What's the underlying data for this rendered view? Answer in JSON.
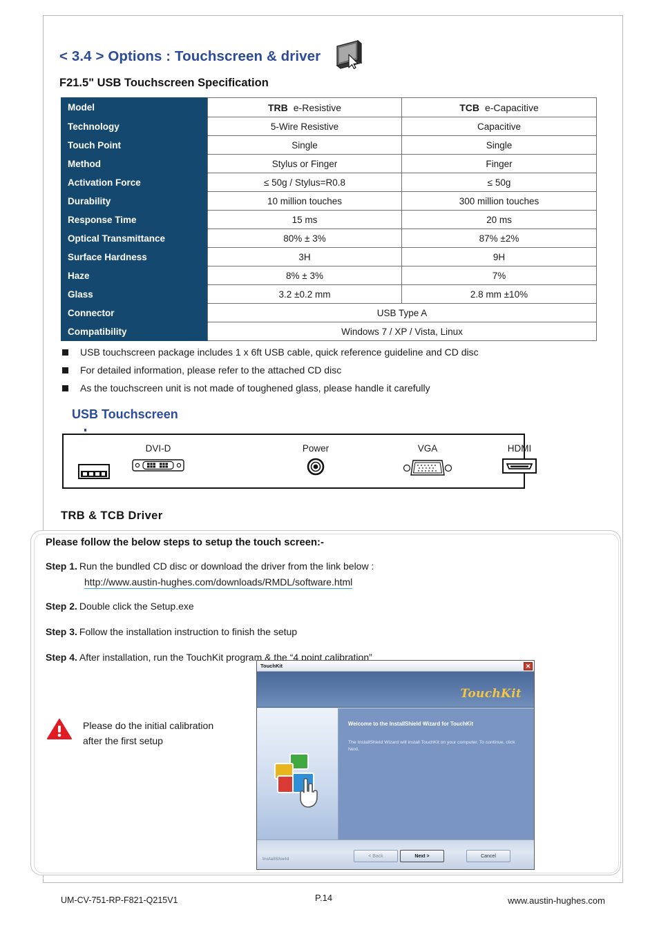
{
  "header": {
    "section_title": "< 3.4 >  Options : Touchscreen & driver",
    "spec_title": "F21.5\" USB Touchscreen Specification",
    "monitor_icon": "touchscreen-monitor-icon"
  },
  "colors": {
    "title_blue": "#2c4a9c",
    "table_head_navy": "#14486e",
    "link_underline": "#3aa8d8",
    "warning_red": "#e01b24"
  },
  "spec_table": {
    "row_header_label": "Model",
    "columns": [
      {
        "code": "TRB",
        "kind": "e-Resistive"
      },
      {
        "code": "TCB",
        "kind": "e-Capacitive"
      }
    ],
    "rows": [
      {
        "label": "Technology",
        "trb": "5-Wire Resistive",
        "tcb": "Capacitive"
      },
      {
        "label": "Touch Point",
        "trb": "Single",
        "tcb": "Single"
      },
      {
        "label": "Method",
        "trb": "Stylus or Finger",
        "tcb": "Finger"
      },
      {
        "label": "Activation Force",
        "trb": "≤ 50g / Stylus=R0.8",
        "tcb": "≤ 50g"
      },
      {
        "label": "Durability",
        "trb": "10 million touches",
        "tcb": "300 million touches"
      },
      {
        "label": "Response Time",
        "trb": "15 ms",
        "tcb": "20 ms"
      },
      {
        "label": "Optical Transmittance",
        "trb": "80% ± 3%",
        "tcb": "87% ±2%"
      },
      {
        "label": "Surface Hardness",
        "trb": "3H",
        "tcb": "9H"
      },
      {
        "label": "Haze",
        "trb": "8% ± 3%",
        "tcb": "7%"
      },
      {
        "label": "Glass",
        "trb": "3.2 ±0.2 mm",
        "tcb": "2.8 mm ±10%"
      }
    ],
    "spanned_rows": [
      {
        "label": "Connector",
        "value": "USB Type A"
      },
      {
        "label": "Compatibility",
        "value": "Windows 7 / XP / Vista, Linux"
      }
    ]
  },
  "notes": [
    "USB touchscreen package includes 1 x 6ft USB cable, quick reference guideline and CD disc",
    "For detailed information, please refer to the attached CD disc",
    "As the touchscreen unit is not made of toughened glass, please handle it carefully"
  ],
  "usb_panel": {
    "heading": "USB Touchscreen",
    "ports": [
      {
        "label": "",
        "icon": "usb-port-icon"
      },
      {
        "label": "DVI-D",
        "icon": "dvi-d-port-icon"
      },
      {
        "label": "Power",
        "icon": "power-jack-icon"
      },
      {
        "label": "VGA",
        "icon": "vga-port-icon"
      },
      {
        "label": "HDMI",
        "icon": "hdmi-port-icon"
      }
    ]
  },
  "driver": {
    "heading": "TRB  &  TCB  Driver",
    "intro": "Please follow the below steps to setup the touch screen:-",
    "steps": [
      {
        "num": "Step 1.",
        "text": "Run the bundled CD disc or download the driver from the link below :",
        "link": "http://www.austin-hughes.com/downloads/RMDL/software.html"
      },
      {
        "num": "Step 2.",
        "text": "Double click the Setup.exe",
        "link": ""
      },
      {
        "num": "Step 3.",
        "text": "Follow the installation instruction to finish the setup",
        "link": ""
      },
      {
        "num": "Step 4.",
        "text": "After installation, run the TouchKit program & the “4 point calibration”",
        "link": ""
      }
    ],
    "warning": {
      "icon": "warning-triangle-icon",
      "line1": "Please do the initial calibration",
      "line2": "after the first setup"
    }
  },
  "installer": {
    "window_title": "TouchKit",
    "close_label": "✕",
    "logo_text": "TouchKit",
    "welcome": "Welcome to the InstallShield Wizard for TouchKit",
    "description": "The InstallShield Wizard will install TouchKit on your computer.  To continue, click Next.",
    "brand_label": "InstallShield",
    "buttons": {
      "back": "< Back",
      "next": "Next >",
      "cancel": "Cancel"
    }
  },
  "footer": {
    "left": "UM-CV-751-RP-F821-Q215V1",
    "center": "P.14",
    "right": "www.austin-hughes.com"
  }
}
